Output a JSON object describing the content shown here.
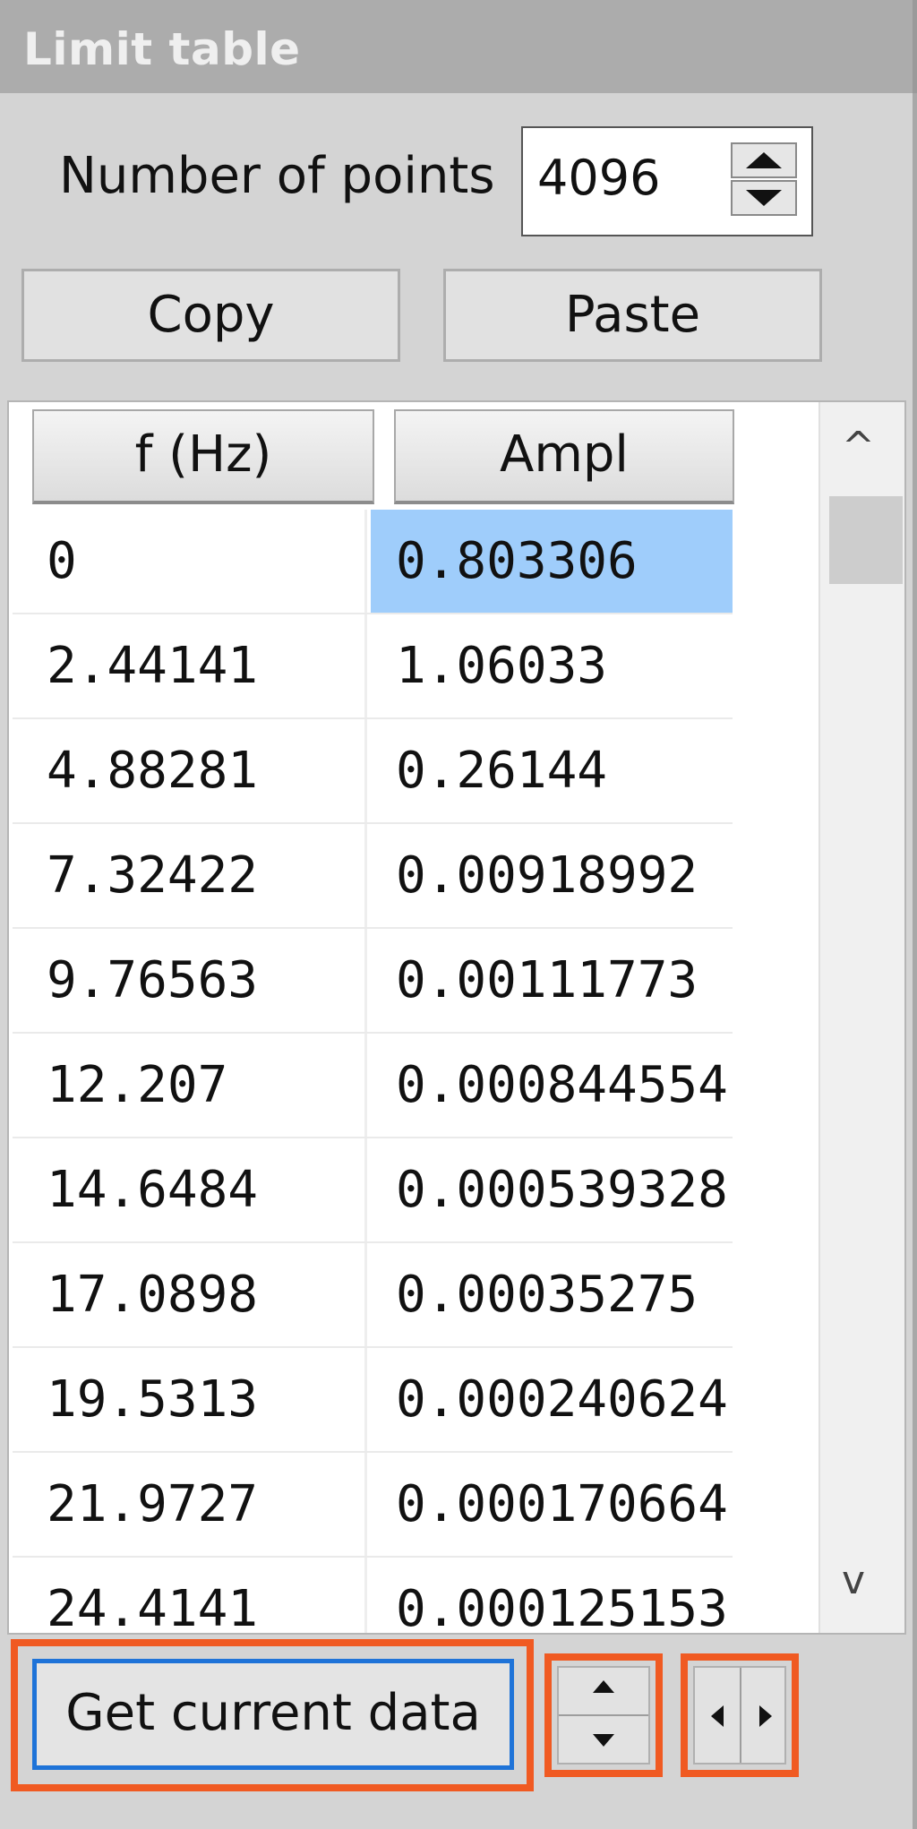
{
  "window": {
    "title": "Limit table"
  },
  "points": {
    "label": "Number of points",
    "value": "4096"
  },
  "buttons": {
    "copy": "Copy",
    "paste": "Paste",
    "get_current_data": "Get current data"
  },
  "table": {
    "columns": [
      "f (Hz)",
      "Ampl"
    ],
    "rows": [
      {
        "f": "0",
        "ampl": "0.803306"
      },
      {
        "f": "2.44141",
        "ampl": "1.06033"
      },
      {
        "f": "4.88281",
        "ampl": "0.26144"
      },
      {
        "f": "7.32422",
        "ampl": "0.00918992"
      },
      {
        "f": "9.76563",
        "ampl": "0.00111773"
      },
      {
        "f": "12.207",
        "ampl": "0.000844554"
      },
      {
        "f": "14.6484",
        "ampl": "0.000539328"
      },
      {
        "f": "17.0898",
        "ampl": "0.00035275"
      },
      {
        "f": "19.5313",
        "ampl": "0.000240624"
      },
      {
        "f": "21.9727",
        "ampl": "0.000170664"
      },
      {
        "f": "24.4141",
        "ampl": "0.000125153"
      }
    ],
    "selected_row": 0,
    "selected_column": "ampl"
  },
  "icons": {
    "spin_up": "triangle-up-icon",
    "spin_down": "triangle-down-icon",
    "scroll_up": "chevron-up-icon",
    "scroll_down": "chevron-down-icon",
    "step_left": "arrow-left-icon",
    "step_right": "arrow-right-icon"
  },
  "colors": {
    "highlight_frame": "#f05a22",
    "selection": "#9fcdfb",
    "focus_border": "#1e73d8",
    "titlebar": "#acacac"
  }
}
